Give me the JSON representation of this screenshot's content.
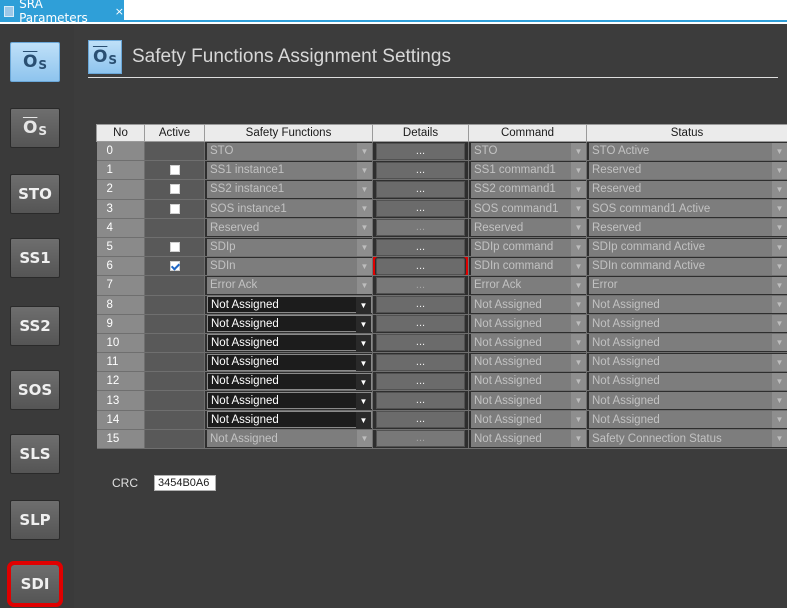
{
  "tab": {
    "title": "SRA Parameters",
    "close": "×"
  },
  "header": {
    "title": "Safety Functions Assignment Settings",
    "icon": "gear-s-icon"
  },
  "sidebar": {
    "items": [
      {
        "label": "S",
        "icon": "gear-s-icon"
      },
      {
        "label": "S",
        "icon": "gear-s-wrench-icon"
      },
      {
        "label": "STO"
      },
      {
        "label": "SS1"
      },
      {
        "label": "SS2"
      },
      {
        "label": "SOS"
      },
      {
        "label": "SLS"
      },
      {
        "label": "SLP"
      },
      {
        "label": "SDI"
      }
    ]
  },
  "table": {
    "columns": [
      "No",
      "Active",
      "Safety Functions",
      "Details",
      "Command",
      "Status"
    ],
    "details_label": "...",
    "rows": [
      {
        "no": "0",
        "checkbox": false,
        "checked": false,
        "function": "STO",
        "command": "STO",
        "status": "STO Active",
        "fn_enabled": false,
        "details_enabled": true
      },
      {
        "no": "1",
        "checkbox": true,
        "checked": false,
        "function": "SS1 instance1",
        "command": "SS1 command1",
        "status": "Reserved",
        "fn_enabled": false,
        "details_enabled": true
      },
      {
        "no": "2",
        "checkbox": true,
        "checked": false,
        "function": "SS2 instance1",
        "command": "SS2 command1",
        "status": "Reserved",
        "fn_enabled": false,
        "details_enabled": true
      },
      {
        "no": "3",
        "checkbox": true,
        "checked": false,
        "function": "SOS instance1",
        "command": "SOS command1",
        "status": "SOS command1 Active",
        "fn_enabled": false,
        "details_enabled": true
      },
      {
        "no": "4",
        "checkbox": false,
        "checked": false,
        "function": "Reserved",
        "command": "Reserved",
        "status": "Reserved",
        "fn_enabled": false,
        "details_enabled": false
      },
      {
        "no": "5",
        "checkbox": true,
        "checked": false,
        "function": "SDIp",
        "command": "SDIp command",
        "status": "SDIp command Active",
        "fn_enabled": false,
        "details_enabled": true
      },
      {
        "no": "6",
        "checkbox": true,
        "checked": true,
        "function": "SDIn",
        "command": "SDIn command",
        "status": "SDIn command Active",
        "fn_enabled": false,
        "details_enabled": true
      },
      {
        "no": "7",
        "checkbox": false,
        "checked": false,
        "function": "Error Ack",
        "command": "Error Ack",
        "status": "Error",
        "fn_enabled": false,
        "details_enabled": false
      },
      {
        "no": "8",
        "checkbox": false,
        "checked": false,
        "function": "Not Assigned",
        "command": "Not Assigned",
        "status": "Not Assigned",
        "fn_enabled": true,
        "details_enabled": true
      },
      {
        "no": "9",
        "checkbox": false,
        "checked": false,
        "function": "Not Assigned",
        "command": "Not Assigned",
        "status": "Not Assigned",
        "fn_enabled": true,
        "details_enabled": true
      },
      {
        "no": "10",
        "checkbox": false,
        "checked": false,
        "function": "Not Assigned",
        "command": "Not Assigned",
        "status": "Not Assigned",
        "fn_enabled": true,
        "details_enabled": true
      },
      {
        "no": "11",
        "checkbox": false,
        "checked": false,
        "function": "Not Assigned",
        "command": "Not Assigned",
        "status": "Not Assigned",
        "fn_enabled": true,
        "details_enabled": true
      },
      {
        "no": "12",
        "checkbox": false,
        "checked": false,
        "function": "Not Assigned",
        "command": "Not Assigned",
        "status": "Not Assigned",
        "fn_enabled": true,
        "details_enabled": true
      },
      {
        "no": "13",
        "checkbox": false,
        "checked": false,
        "function": "Not Assigned",
        "command": "Not Assigned",
        "status": "Not Assigned",
        "fn_enabled": true,
        "details_enabled": true
      },
      {
        "no": "14",
        "checkbox": false,
        "checked": false,
        "function": "Not Assigned",
        "command": "Not Assigned",
        "status": "Not Assigned",
        "fn_enabled": true,
        "details_enabled": true
      },
      {
        "no": "15",
        "checkbox": false,
        "checked": false,
        "function": "Not Assigned",
        "command": "Not Assigned",
        "status": "Safety Connection Status",
        "fn_enabled": false,
        "details_enabled": false
      }
    ]
  },
  "crc": {
    "label": "CRC",
    "value": "3454B0A6"
  },
  "colors": {
    "tab_accent": "#2f9fd8",
    "highlight": "#e00000",
    "workspace": "#3c3c3c"
  }
}
